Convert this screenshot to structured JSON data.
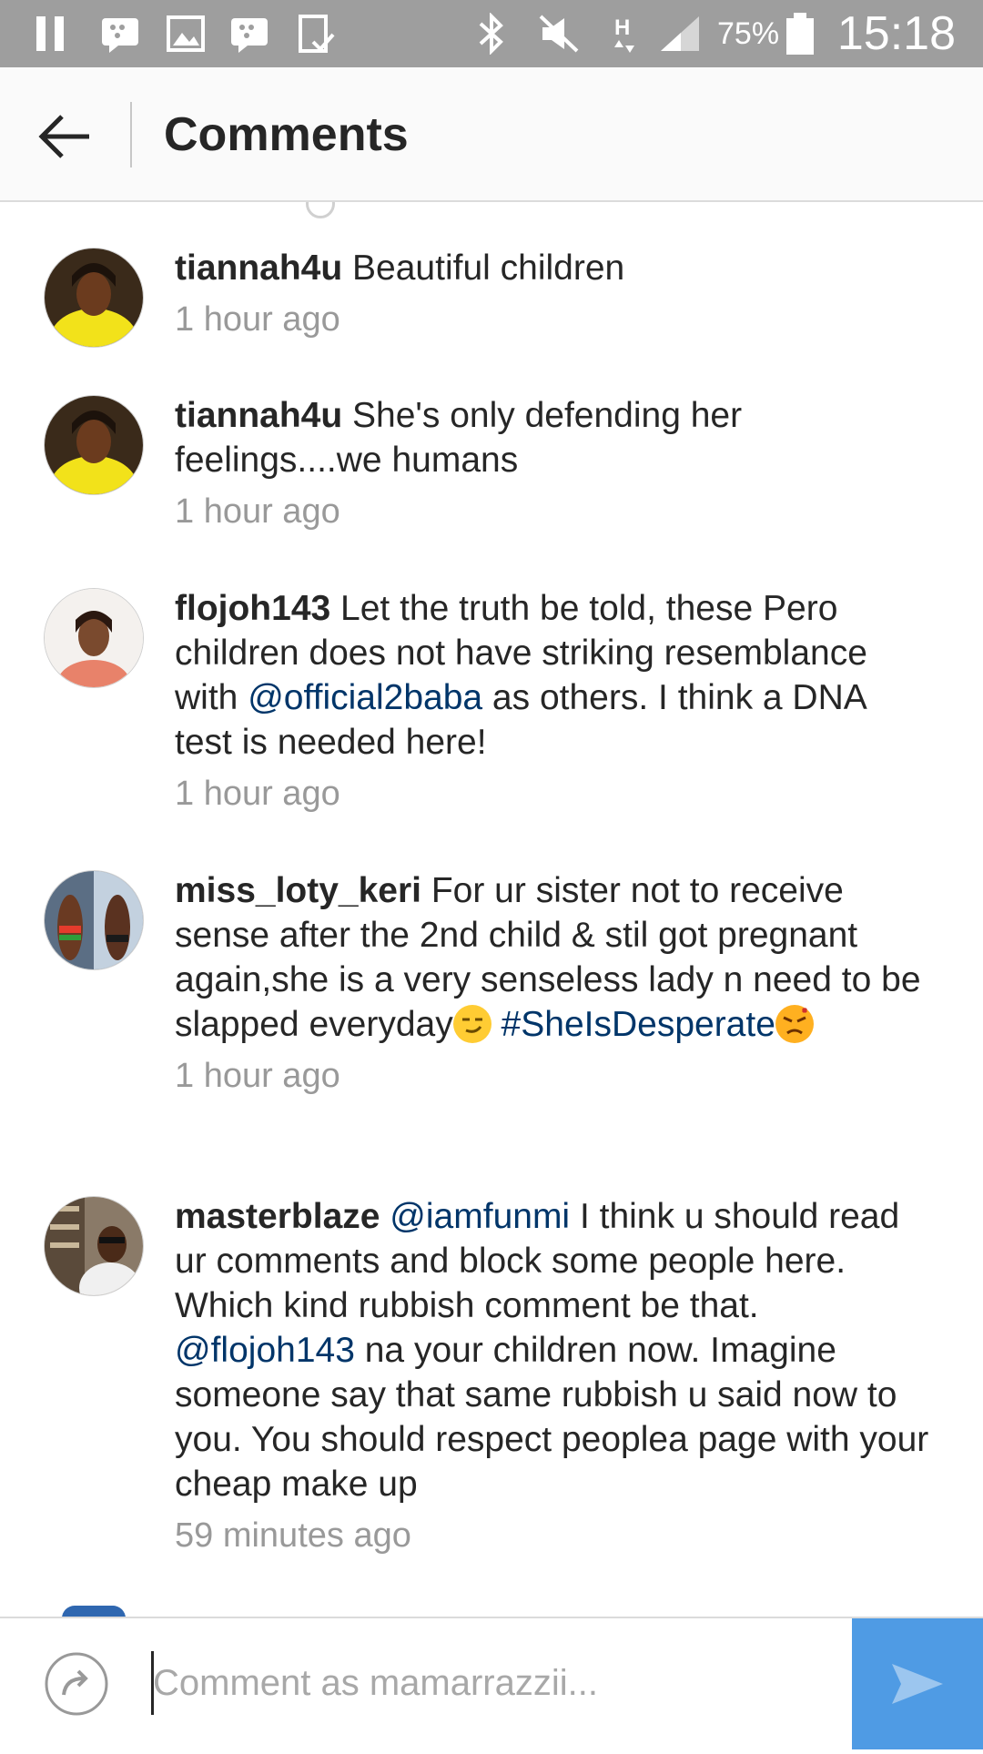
{
  "status_bar": {
    "battery": "75%",
    "time": "15:18",
    "icons": [
      "pause-icon",
      "bbm-icon",
      "gallery-icon",
      "bbm-icon",
      "device-icon",
      "bluetooth-icon",
      "mute-icon",
      "h-data-icon",
      "signal-icon",
      "battery-icon"
    ]
  },
  "header": {
    "title": "Comments",
    "back_icon": "back-arrow-icon"
  },
  "comments": [
    {
      "username": "tiannah4u",
      "text": " Beautiful children",
      "time": "1 hour ago"
    },
    {
      "username": "tiannah4u",
      "text": " She's only defending her feelings....we humans",
      "time": "1 hour ago"
    },
    {
      "username": "flojoh143",
      "text_before": " Let the truth be told, these Pero children does not have striking resemblance with ",
      "mention": "@official2baba",
      "text_after": " as others. I think a DNA test is needed here!",
      "time": "1 hour ago"
    },
    {
      "username": "miss_loty_keri",
      "text": " For ur sister not to receive sense after the 2nd child & stil got pregnant again,she is a very senseless lady n need to be slapped everyday",
      "hashtag": "#SheIsDesperate",
      "time": "1 hour ago"
    },
    {
      "username": "masterblaze",
      "mention1": "@iamfunmi",
      "text_mid": " I think u should read ur comments and block some people here. Which kind rubbish comment be that. ",
      "mention2": "@flojoh143",
      "text_after": " na your children now. Imagine someone say that same rubbish u said now to you. You should respect peoplea page with your cheap make up",
      "time": "59 minutes ago"
    }
  ],
  "input": {
    "placeholder": "Comment as mamarrazzii...",
    "value": ""
  },
  "colors": {
    "link": "#003569",
    "send_button": "#4f9be4",
    "status_bar": "#9e9e9e",
    "timestamp": "#999999"
  }
}
